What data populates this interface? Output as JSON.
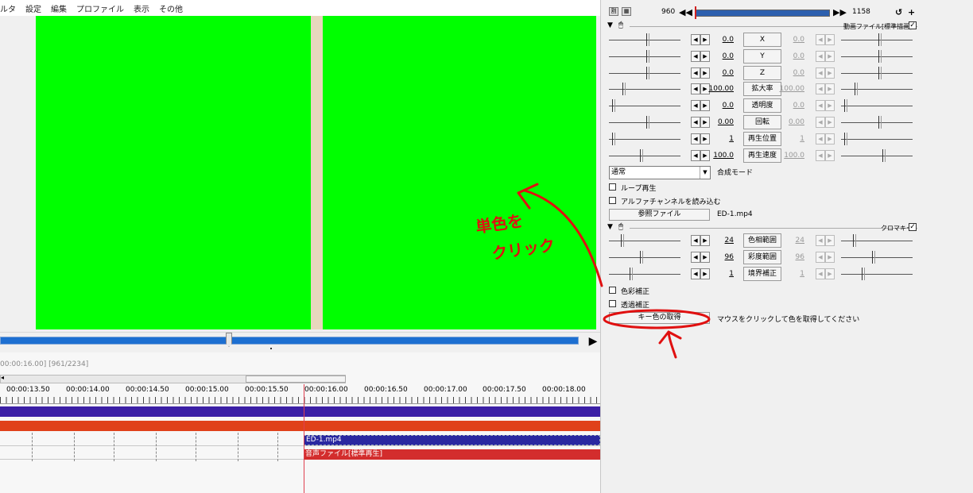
{
  "menu": [
    "ルタ",
    "設定",
    "編集",
    "プロファイル",
    "表示",
    "その他"
  ],
  "timeline": {
    "status": "00:00:16.00] [961/2234]",
    "ruler": [
      "00:00:13.50",
      "00:00:14.00",
      "00:00:14.50",
      "00:00:15.00",
      "00:00:15.50",
      "00:00:16.00",
      "00:00:16.50",
      "00:00:17.00",
      "00:00:17.50",
      "00:00:18.00"
    ],
    "clip_video": "ED-1.mp4",
    "clip_audio": "音声ファイル[標準再生]",
    "layer_colors": {
      "layer1": "#3b1fa6",
      "layer2": "#e0411a"
    }
  },
  "preview": {
    "background": "#00ff00",
    "stripe": "#e8d7bd"
  },
  "panel": {
    "frame_current": "960",
    "frame_total": "1158",
    "section1_title": "動画ファイル[標準描画]",
    "params1": [
      {
        "left_value": "0.0",
        "label": "X",
        "right_value": "0.0",
        "left_knob": 0.55,
        "right_knob": 0.55
      },
      {
        "left_value": "0.0",
        "label": "Y",
        "right_value": "0.0",
        "left_knob": 0.55,
        "right_knob": 0.55
      },
      {
        "left_value": "0.0",
        "label": "Z",
        "right_value": "0.0",
        "left_knob": 0.55,
        "right_knob": 0.55
      },
      {
        "left_value": "100.00",
        "label": "拡大率",
        "right_value": "100.00",
        "left_knob": 0.2,
        "right_knob": 0.2
      },
      {
        "left_value": "0.0",
        "label": "透明度",
        "right_value": "0.0",
        "left_knob": 0.05,
        "right_knob": 0.05
      },
      {
        "left_value": "0.00",
        "label": "回転",
        "right_value": "0.00",
        "left_knob": 0.55,
        "right_knob": 0.55
      },
      {
        "left_value": "1",
        "label": "再生位置",
        "right_value": "1",
        "left_knob": 0.05,
        "right_knob": 0.05
      },
      {
        "left_value": "100.0",
        "label": "再生速度",
        "right_value": "100.0",
        "left_knob": 0.45,
        "right_knob": 0.6
      }
    ],
    "blend_mode_value": "通常",
    "blend_mode_label": "合成モード",
    "loop_label": "ループ再生",
    "alpha_label": "アルファチャンネルを読み込む",
    "ref_file_button": "参照ファイル",
    "ref_file_name": "ED-1.mp4",
    "section2_title": "クロマキー",
    "params2": [
      {
        "left_value": "24",
        "label": "色相範囲",
        "right_value": "24",
        "left_knob": 0.18,
        "right_knob": 0.18
      },
      {
        "left_value": "96",
        "label": "彩度範囲",
        "right_value": "96",
        "left_knob": 0.45,
        "right_knob": 0.45
      },
      {
        "left_value": "1",
        "label": "境界補正",
        "right_value": "1",
        "left_knob": 0.3,
        "right_knob": 0.3
      }
    ],
    "color_correct_label": "色彩補正",
    "transparent_correct_label": "透過補正",
    "key_color_button": "キー色の取得",
    "key_color_hint": "マウスをクリックして色を取得してください"
  },
  "annotation": {
    "text_line1": "単色を",
    "text_line2": "クリック",
    "color": "#e01010"
  }
}
